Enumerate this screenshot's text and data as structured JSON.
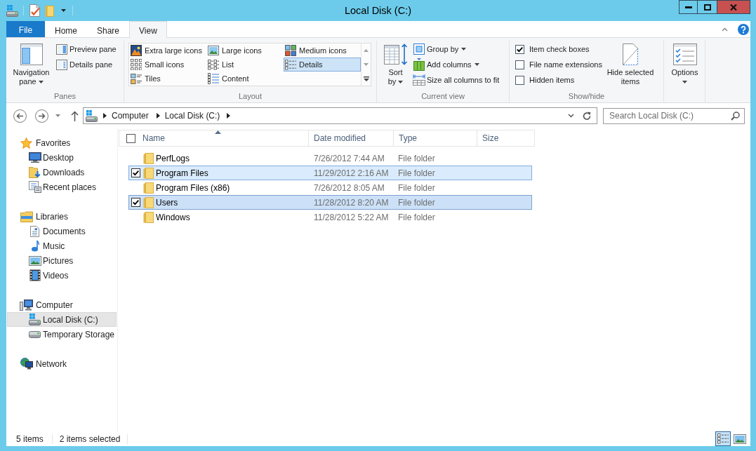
{
  "window": {
    "title": "Local Disk (C:)"
  },
  "ribbon": {
    "tabs": [
      {
        "label": "File",
        "kind": "menu",
        "selected": false
      },
      {
        "label": "Home",
        "kind": "tab",
        "selected": false
      },
      {
        "label": "Share",
        "kind": "tab",
        "selected": false
      },
      {
        "label": "View",
        "kind": "tab",
        "selected": true
      }
    ],
    "groups": [
      {
        "kind": "panes",
        "label": "Panes",
        "large_button": {
          "label": "Navigation pane",
          "dropdown": true
        },
        "buttons": [
          {
            "label": "Preview pane",
            "dropdown": false
          },
          {
            "label": "Details pane",
            "dropdown": false
          }
        ]
      },
      {
        "kind": "layout",
        "label": "Layout",
        "options": [
          {
            "label": "Extra large icons",
            "selected": false
          },
          {
            "label": "Large icons",
            "selected": false
          },
          {
            "label": "Medium icons",
            "selected": false
          },
          {
            "label": "Small icons",
            "selected": false
          },
          {
            "label": "List",
            "selected": false
          },
          {
            "label": "Details",
            "selected": true
          },
          {
            "label": "Tiles",
            "selected": false
          },
          {
            "label": "Content",
            "selected": false
          }
        ]
      },
      {
        "kind": "current_view",
        "label": "Current view",
        "large_button": {
          "label": "Sort by",
          "dropdown": true
        },
        "buttons": [
          {
            "label": "Group by",
            "dropdown": true
          },
          {
            "label": "Add columns",
            "dropdown": true
          },
          {
            "label": "Size all columns to fit",
            "dropdown": false
          }
        ]
      },
      {
        "kind": "show_hide",
        "label": "Show/hide",
        "checkboxes": [
          {
            "label": "Item check boxes",
            "checked": true
          },
          {
            "label": "File name extensions",
            "checked": false
          },
          {
            "label": "Hidden items",
            "checked": false
          }
        ],
        "large_button": {
          "label": "Hide selected items",
          "dropdown": false
        }
      },
      {
        "kind": "options",
        "large_button": {
          "label": "Options",
          "dropdown": true
        }
      }
    ]
  },
  "address_bar": {
    "breadcrumbs": [
      "Computer",
      "Local Disk (C:)"
    ]
  },
  "search": {
    "placeholder": "Search Local Disk (C:)"
  },
  "navigation_pane": {
    "items": [
      {
        "label": "Favorites",
        "selected": false,
        "children": [
          {
            "label": "Desktop",
            "selected": false
          },
          {
            "label": "Downloads",
            "selected": false
          },
          {
            "label": "Recent places",
            "selected": false
          }
        ]
      },
      {
        "label": "Libraries",
        "selected": false,
        "children": [
          {
            "label": "Documents",
            "selected": false
          },
          {
            "label": "Music",
            "selected": false
          },
          {
            "label": "Pictures",
            "selected": false
          },
          {
            "label": "Videos",
            "selected": false
          }
        ]
      },
      {
        "label": "Computer",
        "selected": false,
        "children": [
          {
            "label": "Local Disk (C:)",
            "selected": true
          },
          {
            "label": "Temporary Storage",
            "selected": false
          }
        ]
      },
      {
        "label": "Network",
        "selected": false
      }
    ]
  },
  "file_list": {
    "select_all": {
      "checked": false
    },
    "columns": [
      {
        "label": "Name",
        "sorted": true
      },
      {
        "label": "Date modified",
        "sorted": false
      },
      {
        "label": "Type",
        "sorted": false
      },
      {
        "label": "Size",
        "sorted": false
      }
    ],
    "rows": [
      {
        "name": "PerfLogs",
        "date_modified": "7/26/2012 7:44 AM",
        "type": "File folder",
        "selected": false,
        "focused": false
      },
      {
        "name": "Program Files",
        "date_modified": "11/29/2012 2:16 AM",
        "type": "File folder",
        "selected": true,
        "focused": false
      },
      {
        "name": "Program Files (x86)",
        "date_modified": "7/26/2012 8:05 AM",
        "type": "File folder",
        "selected": false,
        "focused": false
      },
      {
        "name": "Users",
        "date_modified": "11/28/2012 8:20 AM",
        "type": "File folder",
        "selected": true,
        "focused": true
      },
      {
        "name": "Windows",
        "date_modified": "11/28/2012 5:22 AM",
        "type": "File folder",
        "selected": false,
        "focused": false
      }
    ]
  },
  "status_bar": {
    "item_count": "5 items",
    "selection": "2 items selected",
    "view_buttons": [
      {
        "selected": true
      },
      {
        "selected": false
      }
    ]
  }
}
